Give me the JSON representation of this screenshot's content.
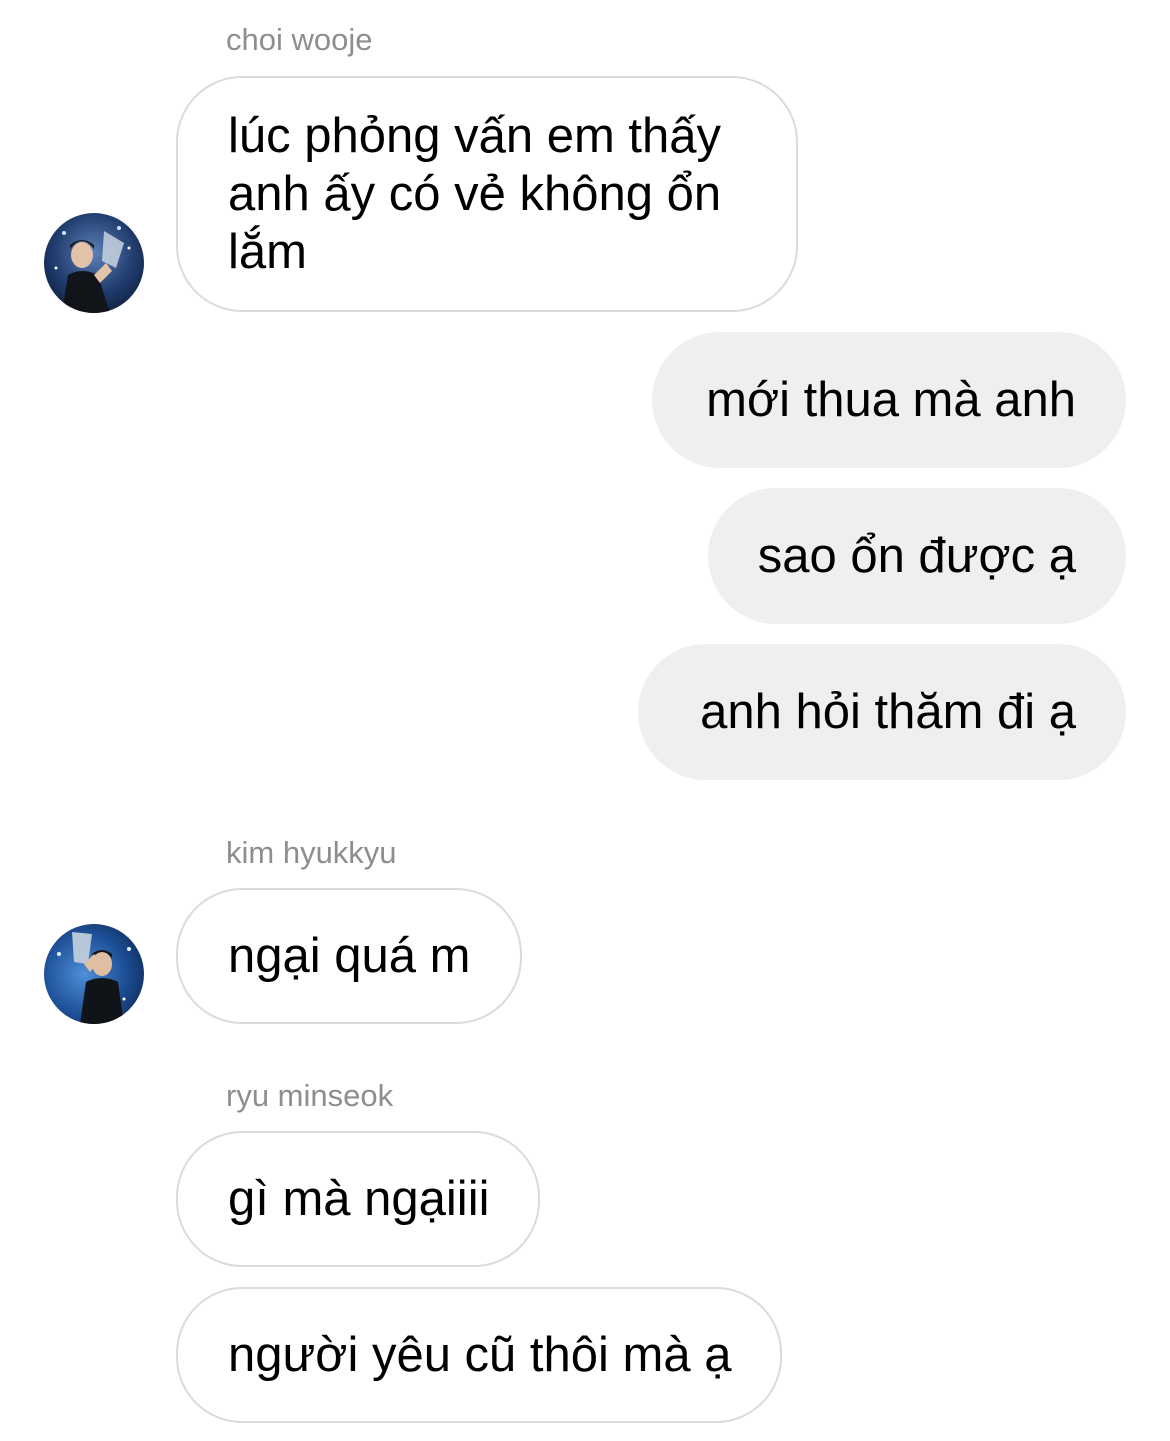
{
  "messages": [
    {
      "sender": "choi wooje",
      "text": "lúc phỏng vấn em thấy anh ấy có vẻ không ổn lắm",
      "direction": "incoming"
    },
    {
      "text": "mới thua mà anh",
      "direction": "outgoing"
    },
    {
      "text": "sao ổn được ạ",
      "direction": "outgoing"
    },
    {
      "text": "anh hỏi thăm đi ạ",
      "direction": "outgoing"
    },
    {
      "sender": "kim hyukkyu",
      "text": "ngại quá m",
      "direction": "incoming"
    },
    {
      "sender": "ryu minseok",
      "text": "gì mà ngạiiii",
      "direction": "incoming"
    },
    {
      "text": "người yêu cũ thôi mà ạ",
      "direction": "incoming"
    }
  ],
  "avatars": [
    {
      "name": "avatar-choi-wooje",
      "icon": "trophy-photo-avatar"
    },
    {
      "name": "avatar-kim-hyukkyu",
      "icon": "trophy-photo-avatar"
    }
  ],
  "colors": {
    "incoming_border": "#dbdbdb",
    "outgoing_bg": "#efefef",
    "sender_text": "#8e8e8e"
  }
}
